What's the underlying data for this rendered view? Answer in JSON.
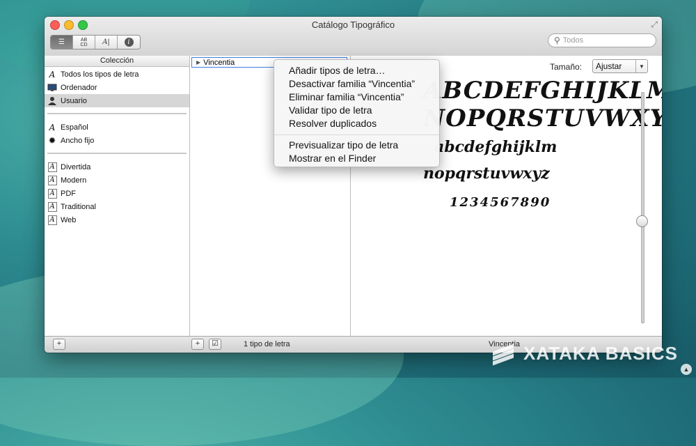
{
  "window": {
    "title": "Catálogo Tipográfico"
  },
  "toolbar": {
    "view_buttons": [
      "",
      "ABCD",
      "A|",
      "i"
    ],
    "search_placeholder": "Todos"
  },
  "collection": {
    "header": "Colección",
    "group1": [
      {
        "label": "Todos los tipos de letra",
        "icon": "font-a-icon"
      },
      {
        "label": "Ordenador",
        "icon": "computer-icon"
      },
      {
        "label": "Usuario",
        "icon": "user-icon",
        "selected": true
      }
    ],
    "group2": [
      {
        "label": "Español",
        "icon": "font-a-icon"
      },
      {
        "label": "Ancho fijo",
        "icon": "gear-icon"
      }
    ],
    "group3": [
      {
        "label": "Divertida"
      },
      {
        "label": "Modern"
      },
      {
        "label": "PDF"
      },
      {
        "label": "Traditional"
      },
      {
        "label": "Web"
      }
    ]
  },
  "families": {
    "selected": "Vincentia"
  },
  "preview": {
    "size_label": "Tamaño:",
    "size_value": "Ajustar",
    "line1": "ABCDEFGHIJKLM",
    "line2": "NOPQRSTUVWXYZ",
    "line3": "abcdefghijklm",
    "line4": "nopqrstuvwxyz",
    "line5": "1234567890"
  },
  "context_menu": {
    "group1": [
      "Añadir tipos de letra…",
      "Desactivar familia “Vincentia”",
      "Eliminar familia “Vincentia”",
      "Validar tipo de letra",
      "Resolver duplicados"
    ],
    "group2": [
      "Previsualizar tipo de letra",
      "Mostrar en el Finder"
    ]
  },
  "footer": {
    "count": "1 tipo de letra",
    "family": "Vincentia"
  },
  "watermark": "XATAKA BASICS"
}
